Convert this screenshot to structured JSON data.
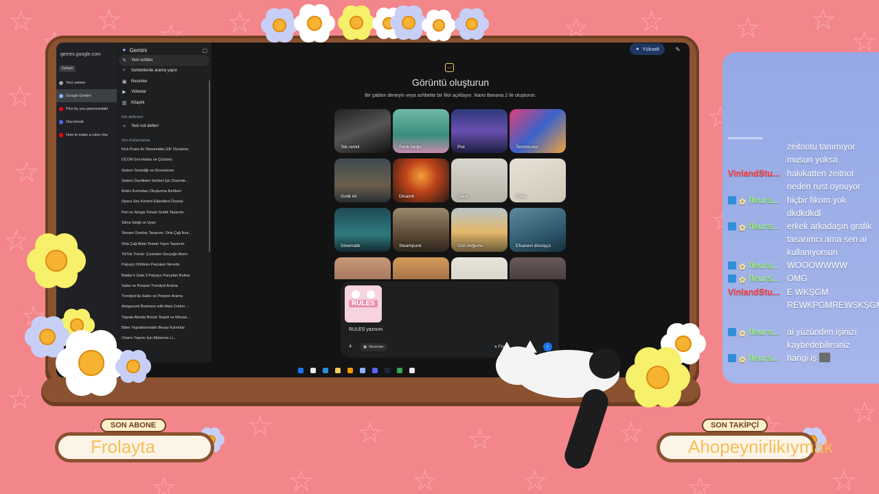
{
  "browser": {
    "url": "gemini.google.com",
    "default_chip": "Default",
    "tabs": [
      {
        "label": "Yeni sekme",
        "color": "#9aa0a6"
      },
      {
        "label": "Google Gemini",
        "color": "#8ab4f8",
        "active": true
      },
      {
        "label": "Pins by you panosundaki",
        "color": "#e60023"
      },
      {
        "label": "Discohook",
        "color": "#5865f2"
      },
      {
        "label": "How to make a rules cha",
        "color": "#ff0000"
      }
    ]
  },
  "sidebar": {
    "title": "Gemini",
    "nav": [
      {
        "label": "Yeni sohbet",
        "icon": "edit-icon",
        "glyph": "✎",
        "active": true
      },
      {
        "label": "Sohbetlerde arama yapın",
        "icon": "search-icon",
        "glyph": "⌕"
      },
      {
        "label": "Resimler",
        "icon": "image-icon",
        "glyph": "▣"
      },
      {
        "label": "Videolar",
        "icon": "video-icon",
        "glyph": "▶"
      },
      {
        "label": "Kitaplık",
        "icon": "library-icon",
        "glyph": "▥"
      }
    ],
    "notebooks_heading": "Not defterleri",
    "new_notebook": "Yeni not defteri",
    "recent_heading": "Son Kullanılanlar",
    "recent": [
      "Kick Puanı ile Streamlabs GIF Oynatma",
      "DCOM İzni Hatası ve Çözümü",
      "Sistem Temizliği ve Düzenleme",
      "Sistem Özellikleri Sohbet İçin Düzenle...",
      "Botrix Komutları Oluşturma Rehberi",
      "Opera Ses Kontrol Eklentileri Önerisi",
      "Peri ve Nergis Temalı Grafik Tasarımı",
      "Silme İsteği ve Uyarı",
      "Stream Overlay Tasarımı: Orta Çağ İksir...",
      "Orta Çağ Aktar Temalı Yayın Tasarımı",
      "TikTok Trendi: Çizimden Gerçeğe Akımı",
      "Palyaço Dribbles Parçaları Nerede",
      "Baldur's Gate 3 Palyaço Parçaları Bulma",
      "Saksı ve Ponpon Trendyol Arama",
      "Trendyol'da Saksı ve Ponpon Arama",
      "Amigurumi Business with Alize Cotton ...",
      "Yaprak Altında Böcek Tespiti ve Mücad...",
      "Biber Yapraklarındaki Beyaz Kalıntılar",
      "Charm Yapımı İçin Malzeme Li..."
    ]
  },
  "main": {
    "upgrade_label": "Yükselt",
    "title": "Görüntü oluşturun",
    "subtitle": "Bir şablon deneyin veya sohbette bir fikir açıklayın. Nano Banana 2 ile oluşturun.",
    "templates": [
      {
        "label": "Tek renkli",
        "bg": "linear-gradient(160deg,#222 0%,#555 50%,#111 100%)"
      },
      {
        "label": "Renk bloğu",
        "bg": "linear-gradient(180deg,#6fb8a8 0%,#3a8e7d 60%,#c98bb0 100%)"
      },
      {
        "label": "Pist",
        "bg": "linear-gradient(180deg,#2d3a7a 0%,#6a4fb0 50%,#1d1f3f 100%)"
      },
      {
        "label": "Technicolor",
        "bg": "linear-gradient(135deg,#e0407a 0%,#3a63c9 50%,#f3a13a 100%)"
      },
      {
        "label": "Gotik kil",
        "bg": "linear-gradient(180deg,#3f4a52 0%,#6b5f4c 60%,#2a2f33 100%)"
      },
      {
        "label": "Dinamit",
        "bg": "radial-gradient(circle at 50% 40%,#f3a13a 0%,#c0431b 40%,#2a1a14 100%)"
      },
      {
        "label": "Salon",
        "bg": "linear-gradient(180deg,#d9d6cf 0%,#b8b3a7 100%)"
      },
      {
        "label": "Eskiz",
        "bg": "linear-gradient(160deg,#e7e2d6 0%,#cfc8b8 100%)"
      },
      {
        "label": "Sinematik",
        "bg": "linear-gradient(180deg,#1f4a55 0%,#2f7a7e 60%,#132a30 100%)"
      },
      {
        "label": "Steampunk",
        "bg": "linear-gradient(180deg,#9a8a6e 0%,#5b4a36 60%,#2f261c 100%)"
      },
      {
        "label": "Gün doğumu",
        "bg": "linear-gradient(180deg,#b9c4c9 0%,#e3b86a 55%,#6b5a3a 100%)"
      },
      {
        "label": "Efsanevi dövüşçü",
        "bg": "linear-gradient(160deg,#5c8a9e 0%,#2f5a6e 60%,#17303c 100%)"
      },
      {
        "label": "",
        "bg": "linear-gradient(180deg,#c79878 0%,#8a5b45 100%)"
      },
      {
        "label": "",
        "bg": "linear-gradient(180deg,#d39a5a 0%,#7a4f32 100%)"
      },
      {
        "label": "",
        "bg": "linear-gradient(180deg,#e7e4dc 0%,#cfc9bb 100%)"
      },
      {
        "label": "",
        "bg": "linear-gradient(180deg,#6a5a5a 0%,#2b2424 100%)"
      }
    ],
    "attachment_text": "RULES",
    "prompt_text": "RULES yazısını",
    "images_chip": "Resimler",
    "model_label": "Flash"
  },
  "taskbar_icons": [
    "#1a73e8",
    "#e8eaed",
    "#2f8fd8",
    "#f5cc58",
    "#f29900",
    "#8ab4f8",
    "#5865f2",
    "#1b2838",
    "#34a853",
    "#e8eaed"
  ],
  "overlay": {
    "last_sub_tag": "SON ABONE",
    "last_sub_name": "Frolayta",
    "last_follow_tag": "SON TAKİPÇİ",
    "last_follow_name": "Ahopeynirlikıymak"
  },
  "chat": [
    {
      "user": "",
      "user_color": "#ff5f5f",
      "badges": [],
      "text": "zeitnotu tanımıyor musun yoksa"
    },
    {
      "user": "VinlandStu...",
      "user_color": "#ff3d3d",
      "badges": [],
      "text": "hakikatten zeitnot neden rust oynuyor"
    },
    {
      "user": "fleurs...",
      "user_color": "#9aef7a",
      "badges": [
        "blue",
        "gear"
      ],
      "text": "hiçbir fikrim yok dkdkdkdl"
    },
    {
      "user": "fleurs...",
      "user_color": "#9aef7a",
      "badges": [
        "blue",
        "gear"
      ],
      "text": "erkek arkadaşın grafik tasarımcı ama sen ai kullanıyorsun"
    },
    {
      "user": "fleurs...",
      "user_color": "#9aef7a",
      "badges": [
        "blue",
        "gear"
      ],
      "text": "WOOOWWWW"
    },
    {
      "user": "fleurs...",
      "user_color": "#9aef7a",
      "badges": [
        "blue",
        "gear"
      ],
      "text": "OMG"
    },
    {
      "user": "VinlandStu...",
      "user_color": "#ff3d3d",
      "badges": [],
      "text": "E WKŞGM REWKPGMREWSKŞGM"
    },
    {
      "user": "fleurs...",
      "user_color": "#9aef7a",
      "badges": [
        "blue",
        "gear"
      ],
      "text": "ai yüzünden işinizi kaybedebilirsiniz"
    },
    {
      "user": "fleurs...",
      "user_color": "#9aef7a",
      "badges": [
        "blue",
        "gear"
      ],
      "text": "hangi iş"
    }
  ]
}
